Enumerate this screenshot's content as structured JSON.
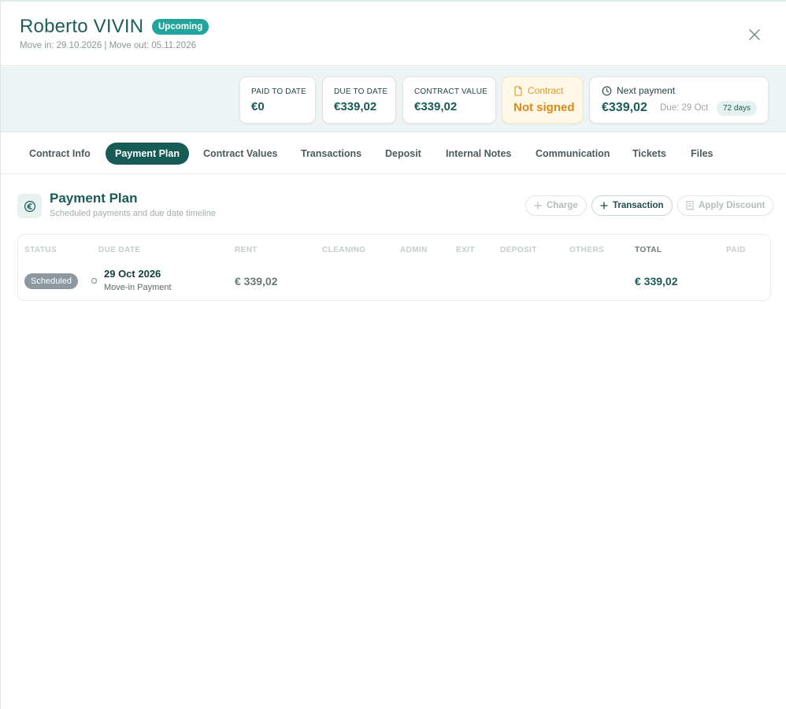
{
  "header": {
    "tenant_name": "Roberto VIVIN",
    "status_badge": "Upcoming",
    "move_dates": "Move in: 29.10.2026 | Move out: 05.11.2026"
  },
  "summary": {
    "paid_to_date": {
      "label": "PAID TO DATE",
      "value": "€0"
    },
    "due_to_date": {
      "label": "DUE TO DATE",
      "value": "€339,02"
    },
    "contract_value": {
      "label": "CONTRACT VALUE",
      "value": "€339,02"
    },
    "contract": {
      "label": "Contract",
      "value": "Not signed"
    },
    "next_payment": {
      "label": "Next payment",
      "value": "€339,02",
      "due": "Due: 29 Oct",
      "days": "72 days"
    }
  },
  "tabs": [
    {
      "label": "Contract Info"
    },
    {
      "label": "Payment Plan"
    },
    {
      "label": "Contract Values"
    },
    {
      "label": "Transactions"
    },
    {
      "label": "Deposit"
    },
    {
      "label": "Internal Notes"
    },
    {
      "label": "Communication"
    },
    {
      "label": "Tickets"
    },
    {
      "label": "Files"
    }
  ],
  "section": {
    "title": "Payment Plan",
    "subtitle": "Scheduled payments and due date timeline",
    "buttons": {
      "charge": "Charge",
      "transaction": "Transaction",
      "discount": "Apply Discount"
    }
  },
  "table": {
    "headers": [
      "STATUS",
      "DUE DATE",
      "RENT",
      "CLEANING",
      "ADMIN",
      "EXIT",
      "DEPOSIT",
      "OTHERS",
      "TOTAL",
      "PAID"
    ],
    "rows": [
      {
        "status": "Scheduled",
        "due_date": "29 Oct 2026",
        "description": "Move-in Payment",
        "rent": "€ 339,02",
        "total": "€ 339,02"
      }
    ]
  },
  "colors": {
    "brand": "#165b55",
    "upcoming_badge": "#21a59a",
    "warning": "#d98a1a"
  }
}
